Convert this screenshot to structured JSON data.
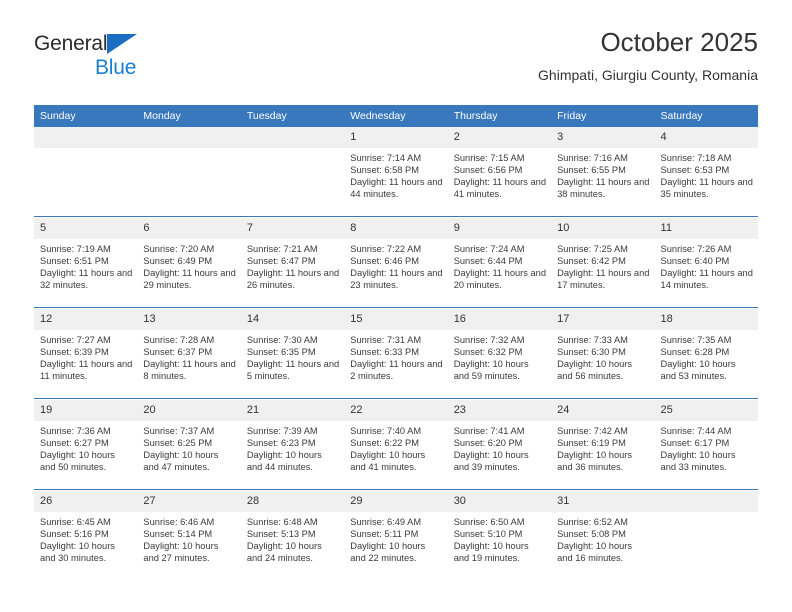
{
  "brand": {
    "line1": "General",
    "line2": "Blue",
    "flag_icon": "triangle-flag-icon",
    "accent_color": "#1b6ec2",
    "text_color": "#1b7fd4"
  },
  "header": {
    "title": "October 2025",
    "subtitle": "Ghimpati, Giurgiu County, Romania"
  },
  "colors": {
    "header_blue": "#3a78bd",
    "daynum_band": "#f0f0f0",
    "body_text": "#3b3b3b"
  },
  "calendar": {
    "weekday_headers": [
      "Sunday",
      "Monday",
      "Tuesday",
      "Wednesday",
      "Thursday",
      "Friday",
      "Saturday"
    ],
    "weeks": [
      [
        {
          "day": "",
          "sunrise": "",
          "sunset": "",
          "daylight": ""
        },
        {
          "day": "",
          "sunrise": "",
          "sunset": "",
          "daylight": ""
        },
        {
          "day": "",
          "sunrise": "",
          "sunset": "",
          "daylight": ""
        },
        {
          "day": "1",
          "sunrise": "Sunrise: 7:14 AM",
          "sunset": "Sunset: 6:58 PM",
          "daylight": "Daylight: 11 hours and 44 minutes."
        },
        {
          "day": "2",
          "sunrise": "Sunrise: 7:15 AM",
          "sunset": "Sunset: 6:56 PM",
          "daylight": "Daylight: 11 hours and 41 minutes."
        },
        {
          "day": "3",
          "sunrise": "Sunrise: 7:16 AM",
          "sunset": "Sunset: 6:55 PM",
          "daylight": "Daylight: 11 hours and 38 minutes."
        },
        {
          "day": "4",
          "sunrise": "Sunrise: 7:18 AM",
          "sunset": "Sunset: 6:53 PM",
          "daylight": "Daylight: 11 hours and 35 minutes."
        }
      ],
      [
        {
          "day": "5",
          "sunrise": "Sunrise: 7:19 AM",
          "sunset": "Sunset: 6:51 PM",
          "daylight": "Daylight: 11 hours and 32 minutes."
        },
        {
          "day": "6",
          "sunrise": "Sunrise: 7:20 AM",
          "sunset": "Sunset: 6:49 PM",
          "daylight": "Daylight: 11 hours and 29 minutes."
        },
        {
          "day": "7",
          "sunrise": "Sunrise: 7:21 AM",
          "sunset": "Sunset: 6:47 PM",
          "daylight": "Daylight: 11 hours and 26 minutes."
        },
        {
          "day": "8",
          "sunrise": "Sunrise: 7:22 AM",
          "sunset": "Sunset: 6:46 PM",
          "daylight": "Daylight: 11 hours and 23 minutes."
        },
        {
          "day": "9",
          "sunrise": "Sunrise: 7:24 AM",
          "sunset": "Sunset: 6:44 PM",
          "daylight": "Daylight: 11 hours and 20 minutes."
        },
        {
          "day": "10",
          "sunrise": "Sunrise: 7:25 AM",
          "sunset": "Sunset: 6:42 PM",
          "daylight": "Daylight: 11 hours and 17 minutes."
        },
        {
          "day": "11",
          "sunrise": "Sunrise: 7:26 AM",
          "sunset": "Sunset: 6:40 PM",
          "daylight": "Daylight: 11 hours and 14 minutes."
        }
      ],
      [
        {
          "day": "12",
          "sunrise": "Sunrise: 7:27 AM",
          "sunset": "Sunset: 6:39 PM",
          "daylight": "Daylight: 11 hours and 11 minutes."
        },
        {
          "day": "13",
          "sunrise": "Sunrise: 7:28 AM",
          "sunset": "Sunset: 6:37 PM",
          "daylight": "Daylight: 11 hours and 8 minutes."
        },
        {
          "day": "14",
          "sunrise": "Sunrise: 7:30 AM",
          "sunset": "Sunset: 6:35 PM",
          "daylight": "Daylight: 11 hours and 5 minutes."
        },
        {
          "day": "15",
          "sunrise": "Sunrise: 7:31 AM",
          "sunset": "Sunset: 6:33 PM",
          "daylight": "Daylight: 11 hours and 2 minutes."
        },
        {
          "day": "16",
          "sunrise": "Sunrise: 7:32 AM",
          "sunset": "Sunset: 6:32 PM",
          "daylight": "Daylight: 10 hours and 59 minutes."
        },
        {
          "day": "17",
          "sunrise": "Sunrise: 7:33 AM",
          "sunset": "Sunset: 6:30 PM",
          "daylight": "Daylight: 10 hours and 56 minutes."
        },
        {
          "day": "18",
          "sunrise": "Sunrise: 7:35 AM",
          "sunset": "Sunset: 6:28 PM",
          "daylight": "Daylight: 10 hours and 53 minutes."
        }
      ],
      [
        {
          "day": "19",
          "sunrise": "Sunrise: 7:36 AM",
          "sunset": "Sunset: 6:27 PM",
          "daylight": "Daylight: 10 hours and 50 minutes."
        },
        {
          "day": "20",
          "sunrise": "Sunrise: 7:37 AM",
          "sunset": "Sunset: 6:25 PM",
          "daylight": "Daylight: 10 hours and 47 minutes."
        },
        {
          "day": "21",
          "sunrise": "Sunrise: 7:39 AM",
          "sunset": "Sunset: 6:23 PM",
          "daylight": "Daylight: 10 hours and 44 minutes."
        },
        {
          "day": "22",
          "sunrise": "Sunrise: 7:40 AM",
          "sunset": "Sunset: 6:22 PM",
          "daylight": "Daylight: 10 hours and 41 minutes."
        },
        {
          "day": "23",
          "sunrise": "Sunrise: 7:41 AM",
          "sunset": "Sunset: 6:20 PM",
          "daylight": "Daylight: 10 hours and 39 minutes."
        },
        {
          "day": "24",
          "sunrise": "Sunrise: 7:42 AM",
          "sunset": "Sunset: 6:19 PM",
          "daylight": "Daylight: 10 hours and 36 minutes."
        },
        {
          "day": "25",
          "sunrise": "Sunrise: 7:44 AM",
          "sunset": "Sunset: 6:17 PM",
          "daylight": "Daylight: 10 hours and 33 minutes."
        }
      ],
      [
        {
          "day": "26",
          "sunrise": "Sunrise: 6:45 AM",
          "sunset": "Sunset: 5:16 PM",
          "daylight": "Daylight: 10 hours and 30 minutes."
        },
        {
          "day": "27",
          "sunrise": "Sunrise: 6:46 AM",
          "sunset": "Sunset: 5:14 PM",
          "daylight": "Daylight: 10 hours and 27 minutes."
        },
        {
          "day": "28",
          "sunrise": "Sunrise: 6:48 AM",
          "sunset": "Sunset: 5:13 PM",
          "daylight": "Daylight: 10 hours and 24 minutes."
        },
        {
          "day": "29",
          "sunrise": "Sunrise: 6:49 AM",
          "sunset": "Sunset: 5:11 PM",
          "daylight": "Daylight: 10 hours and 22 minutes."
        },
        {
          "day": "30",
          "sunrise": "Sunrise: 6:50 AM",
          "sunset": "Sunset: 5:10 PM",
          "daylight": "Daylight: 10 hours and 19 minutes."
        },
        {
          "day": "31",
          "sunrise": "Sunrise: 6:52 AM",
          "sunset": "Sunset: 5:08 PM",
          "daylight": "Daylight: 10 hours and 16 minutes."
        },
        {
          "day": "",
          "sunrise": "",
          "sunset": "",
          "daylight": ""
        }
      ]
    ]
  }
}
